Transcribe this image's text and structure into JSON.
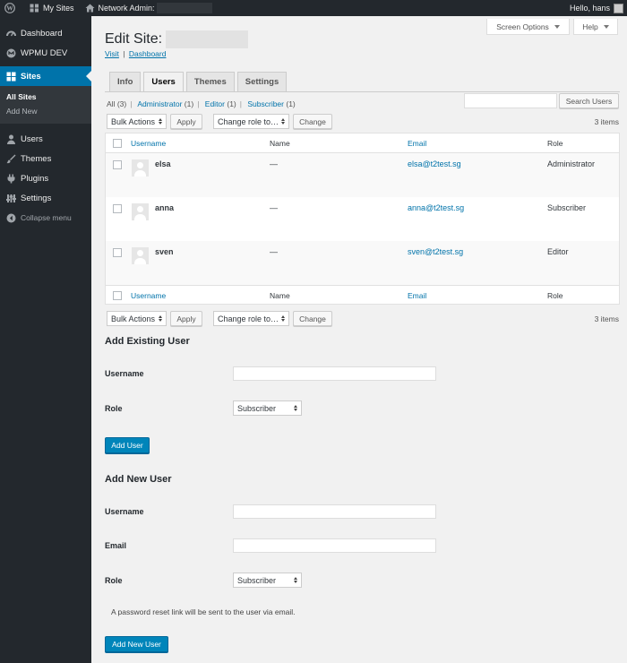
{
  "adminbar": {
    "my_sites": "My Sites",
    "network_admin": "Network Admin:",
    "greeting": "Hello, hans"
  },
  "sidebar": {
    "items": [
      {
        "label": "Dashboard",
        "icon": "dashboard-icon"
      },
      {
        "label": "WPMU DEV",
        "icon": "wpmudev-icon"
      },
      {
        "label": "Sites",
        "icon": "sites-icon"
      }
    ],
    "submenu": [
      "All Sites",
      "Add New"
    ],
    "items2": [
      {
        "label": "Users",
        "icon": "users-icon"
      },
      {
        "label": "Themes",
        "icon": "themes-icon"
      },
      {
        "label": "Plugins",
        "icon": "plugins-icon"
      },
      {
        "label": "Settings",
        "icon": "settings-icon"
      }
    ],
    "collapse": "Collapse menu"
  },
  "header": {
    "screen_options": "Screen Options",
    "help": "Help",
    "title": "Edit Site:",
    "visit": "Visit",
    "link_sep": "|",
    "dashboard": "Dashboard"
  },
  "tabs": [
    "Info",
    "Users",
    "Themes",
    "Settings"
  ],
  "filters": {
    "all": "All",
    "all_count": "(3)",
    "administrator": "Administrator",
    "administrator_count": "(1)",
    "editor": "Editor",
    "editor_count": "(1)",
    "subscriber": "Subscriber",
    "subscriber_count": "(1)",
    "sep": "|"
  },
  "search_button": "Search Users",
  "bulk": {
    "bulk_actions": "Bulk Actions",
    "apply": "Apply",
    "change_role": "Change role to…",
    "change": "Change",
    "items": "3 items"
  },
  "table": {
    "headers": {
      "username": "Username",
      "name": "Name",
      "email": "Email",
      "role": "Role"
    },
    "rows": [
      {
        "username": "elsa",
        "name": "—",
        "email": "elsa@t2test.sg",
        "role": "Administrator"
      },
      {
        "username": "anna",
        "name": "—",
        "email": "anna@t2test.sg",
        "role": "Subscriber"
      },
      {
        "username": "sven",
        "name": "—",
        "email": "sven@t2test.sg",
        "role": "Editor"
      }
    ]
  },
  "add_existing": {
    "heading": "Add Existing User",
    "username_label": "Username",
    "role_label": "Role",
    "role_value": "Subscriber",
    "button": "Add User"
  },
  "add_new": {
    "heading": "Add New User",
    "username_label": "Username",
    "email_label": "Email",
    "role_label": "Role",
    "role_value": "Subscriber",
    "note": "A password reset link will be sent to the user via email.",
    "button": "Add New User"
  },
  "colors": {
    "accent": "#0073aa",
    "primary_button": "#0085ba",
    "adminbar": "#23282d"
  }
}
